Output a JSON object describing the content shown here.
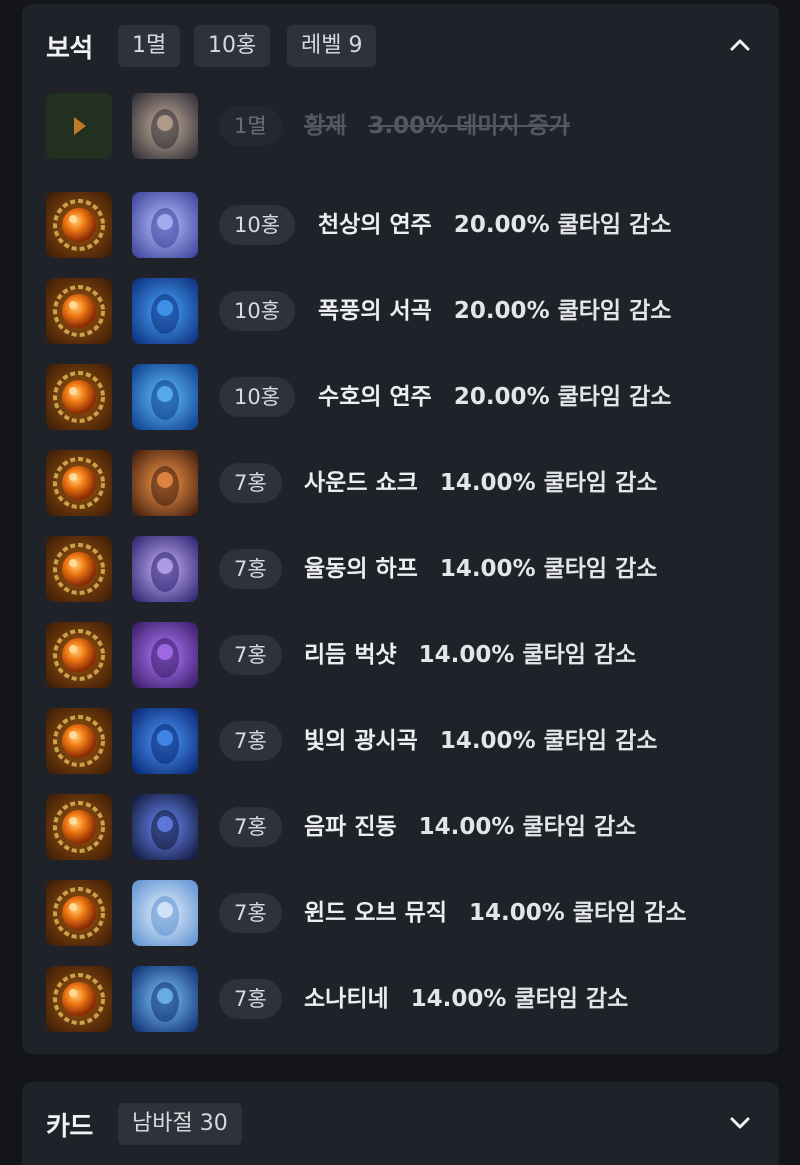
{
  "gems_panel": {
    "title": "보석",
    "chips": [
      "1멸",
      "10홍",
      "레벨 9"
    ],
    "expanded": true,
    "rows": [
      {
        "gem": "멸화",
        "level": "1멸",
        "skill": "황제",
        "effect": "3.00% 데미지 증가",
        "disabled": true
      },
      {
        "gem": "홍염",
        "level": "10홍",
        "skill": "천상의 연주",
        "effect": "20.00% 쿨타임 감소",
        "disabled": false
      },
      {
        "gem": "홍염",
        "level": "10홍",
        "skill": "폭풍의 서곡",
        "effect": "20.00% 쿨타임 감소",
        "disabled": false
      },
      {
        "gem": "홍염",
        "level": "10홍",
        "skill": "수호의 연주",
        "effect": "20.00% 쿨타임 감소",
        "disabled": false
      },
      {
        "gem": "홍염",
        "level": "7홍",
        "skill": "사운드 쇼크",
        "effect": "14.00% 쿨타임 감소",
        "disabled": false
      },
      {
        "gem": "홍염",
        "level": "7홍",
        "skill": "율동의 하프",
        "effect": "14.00% 쿨타임 감소",
        "disabled": false
      },
      {
        "gem": "홍염",
        "level": "7홍",
        "skill": "리듬 벅샷",
        "effect": "14.00% 쿨타임 감소",
        "disabled": false
      },
      {
        "gem": "홍염",
        "level": "7홍",
        "skill": "빛의 광시곡",
        "effect": "14.00% 쿨타임 감소",
        "disabled": false
      },
      {
        "gem": "홍염",
        "level": "7홍",
        "skill": "음파 진동",
        "effect": "14.00% 쿨타임 감소",
        "disabled": false
      },
      {
        "gem": "홍염",
        "level": "7홍",
        "skill": "윈드 오브 뮤직",
        "effect": "14.00% 쿨타임 감소",
        "disabled": false
      },
      {
        "gem": "홍염",
        "level": "7홍",
        "skill": "소나티네",
        "effect": "14.00% 쿨타임 감소",
        "disabled": false
      }
    ]
  },
  "cards_panel": {
    "title": "카드",
    "chips": [
      "남바절 30"
    ],
    "expanded": false
  },
  "colors": {
    "background": "#13151a",
    "panel": "#1f2229",
    "chip": "#2e323b",
    "text": "#eceef1"
  }
}
